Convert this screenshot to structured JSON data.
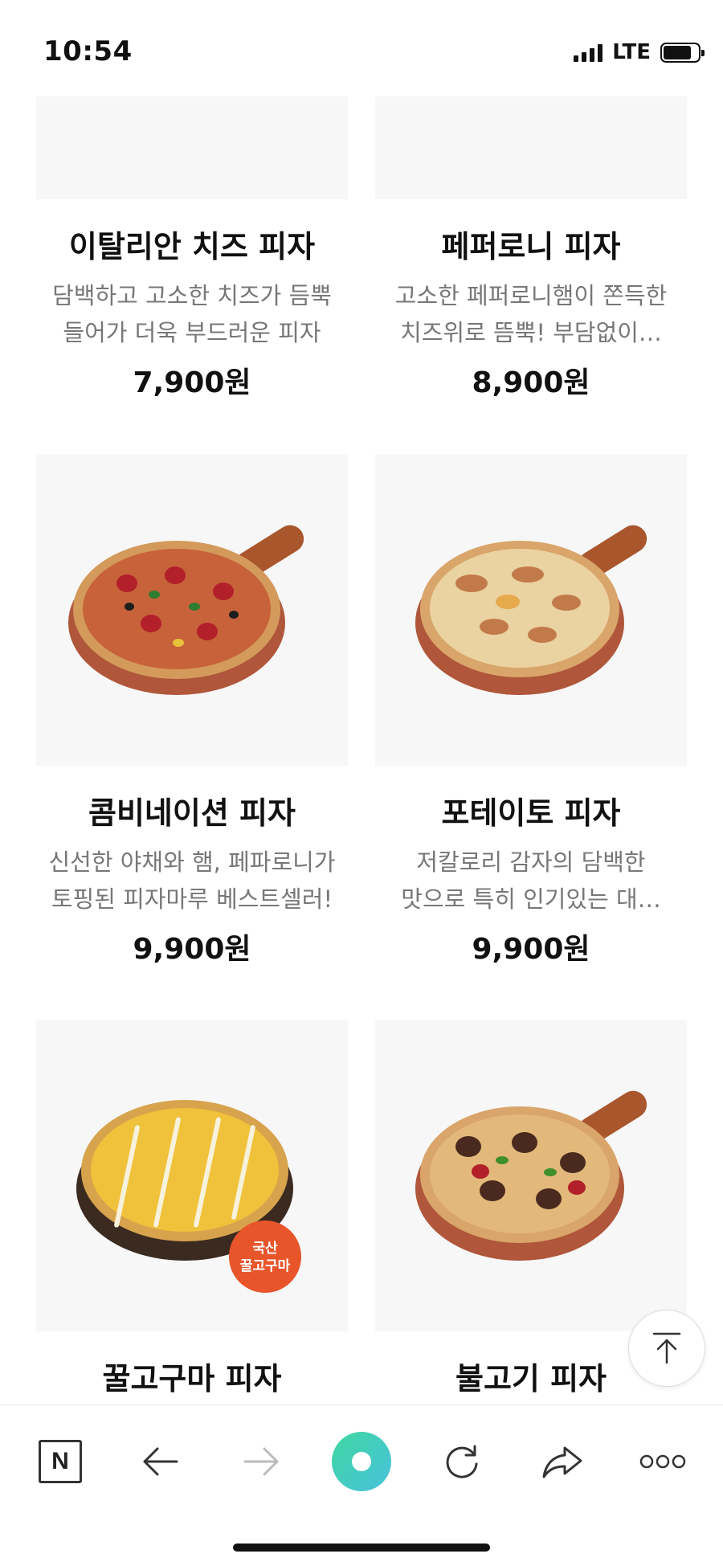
{
  "status_bar": {
    "time": "10:54",
    "network": "LTE"
  },
  "products": [
    {
      "name": "이탈리안 치즈 피자",
      "desc_line1": "담백하고 고소한 치즈가 듬뿍",
      "desc_line2": "들어가 더욱 부드러운 피자",
      "price": "7,900원"
    },
    {
      "name": "페퍼로니 피자",
      "desc_line1": "고소한 페퍼로니햄이 쫀득한",
      "desc_line2": "치즈위로 뜸뿍! 부담없이…",
      "price": "8,900원"
    },
    {
      "name": "콤비네이션 피자",
      "desc_line1": "신선한 야채와 햄, 페파로니가",
      "desc_line2": "토핑된 피자마루 베스트셀러!",
      "price": "9,900원"
    },
    {
      "name": "포테이토 피자",
      "desc_line1": "저칼로리 감자의 담백한",
      "desc_line2": "맛으로 특히 인기있는 대…",
      "price": "9,900원"
    },
    {
      "name": "꿀고구마 피자",
      "badge": "국산\n꿀고구마",
      "badge_line1": "국산",
      "badge_line2": "꿀고구마"
    },
    {
      "name": "불고기 피자"
    }
  ],
  "toolbar": {
    "items": [
      "naver-home",
      "back",
      "forward",
      "green-dot",
      "refresh",
      "share",
      "more"
    ],
    "home_label": "N"
  },
  "colors": {
    "accent_green": "#3ed6a0",
    "sticker_orange": "#e8552a",
    "price_text": "#111111",
    "desc_text": "#777777"
  }
}
